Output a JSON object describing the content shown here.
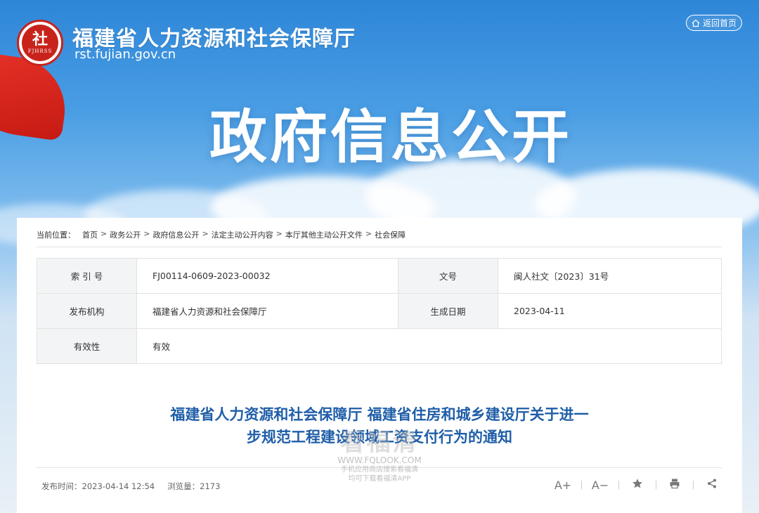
{
  "header": {
    "logo_char": "社",
    "logo_abbr": "FJHRSS",
    "site_name": "福建省人力资源和社会保障厅",
    "site_url": "rst.fujian.gov.cn",
    "home_button": "返回首页",
    "hero_title": "政府信息公开"
  },
  "breadcrumb": {
    "lead": "当前位置：",
    "items": [
      "首页",
      "政务公开",
      "政府信息公开",
      "法定主动公开内容",
      "本厅其他主动公开文件",
      "社会保障"
    ],
    "separator": ">"
  },
  "meta": {
    "index_label": "索 引 号",
    "index_value": "FJ00114-0609-2023-00032",
    "docno_label": "文号",
    "docno_value": "闽人社文〔2023〕31号",
    "org_label": "发布机构",
    "org_value": "福建省人力资源和社会保障厅",
    "date_label": "生成日期",
    "date_value": "2023-04-11",
    "validity_label": "有效性",
    "validity_value": "有效"
  },
  "document": {
    "title_line1": "福建省人力资源和社会保障厅 福建省住房和城乡建设厅关于进一",
    "title_line2": "步规范工程建设领域工资支付行为的通知",
    "publish_time": "发布时间：2023-04-14 12:54",
    "views": "浏览量：2173"
  },
  "tools": {
    "font_up": "A+",
    "font_down": "A−"
  },
  "watermark": {
    "big": "看福清",
    "url": "WWW.FQLOOK.COM",
    "line1": "手机应用商店搜索看福清",
    "line2": "均可下载看福清APP"
  }
}
